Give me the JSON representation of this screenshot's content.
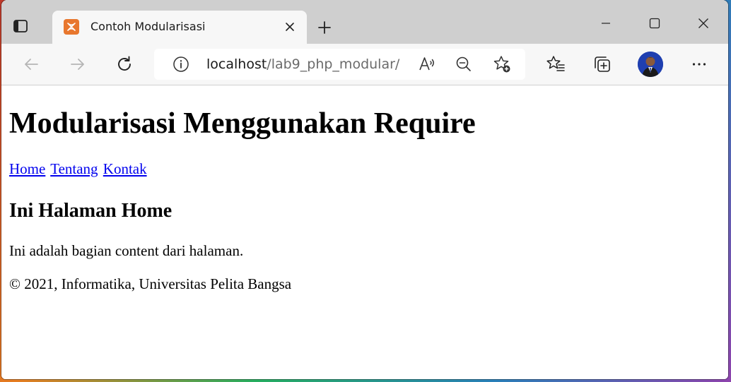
{
  "browser": {
    "tab": {
      "title": "Contoh Modularisasi",
      "favicon": "xampp-icon"
    },
    "address": {
      "host": "localhost",
      "path": "/lab9_php_modular/"
    },
    "icons": {
      "tab_actions": "tab-actions-icon",
      "new_tab": "plus-icon",
      "minimize": "minimize-icon",
      "maximize": "maximize-icon",
      "close": "close-icon",
      "back": "back-arrow-icon",
      "forward": "forward-arrow-icon",
      "refresh": "refresh-icon",
      "site_info": "info-icon",
      "read_aloud": "read-aloud-icon",
      "zoom": "zoom-out-icon",
      "add_favorite": "add-favorite-icon",
      "favorites": "favorites-icon",
      "collections": "collections-icon",
      "profile": "avatar",
      "more": "more-icon"
    },
    "colors": {
      "tab_strip": "#cfcfcf",
      "toolbar": "#f7f7f7",
      "favicon": "#e8772e",
      "link": "#0000ee"
    }
  },
  "page": {
    "title": "Modularisasi Menggunakan Require",
    "nav": {
      "home": "Home",
      "tentang": "Tentang",
      "kontak": "Kontak"
    },
    "heading": "Ini Halaman Home",
    "content": "Ini adalah bagian content dari halaman.",
    "footer": "© 2021, Informatika, Universitas Pelita Bangsa"
  }
}
